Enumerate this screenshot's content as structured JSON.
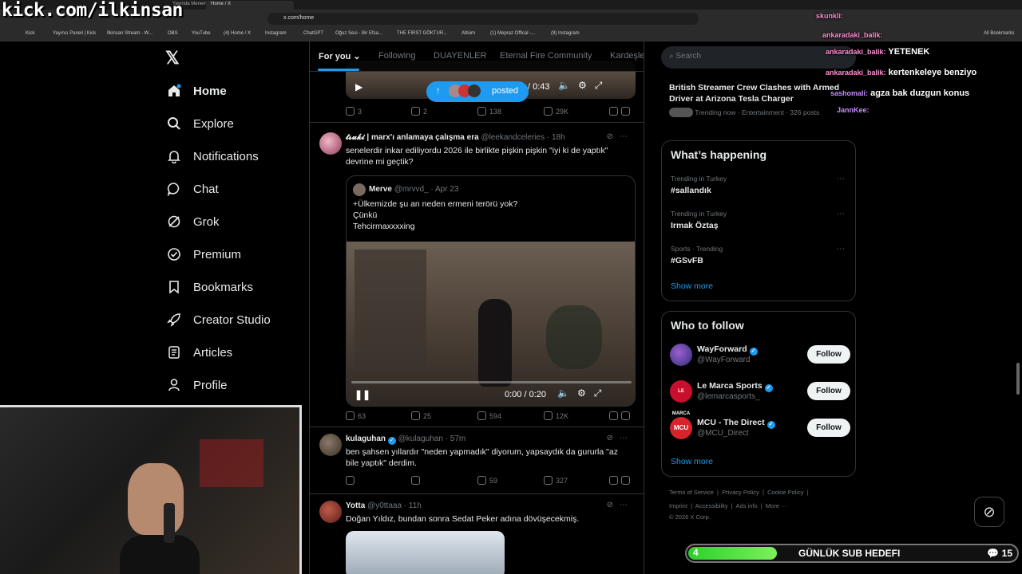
{
  "browser": {
    "tabs": [
      "Yayında Menemen - TARKAN - Yo",
      "Home / X"
    ],
    "url": "x.com/home",
    "bookmarks": [
      "Kick",
      "Yayıncı Paneli | Kick",
      "İlkinsan Stream - W...",
      "OBS",
      "YouTube",
      "(4) Home / X",
      "Instagram",
      "ChatGPT",
      "Oğuz Sesi - Bir Efsa...",
      "THE FIRST GÖKTUR...",
      "Albüm",
      "(1) Mepraz Offical -...",
      "(9) Instagram",
      "All Bookmarks"
    ]
  },
  "overlay": {
    "kick_url": "kick.com/ilkinsan"
  },
  "sidebar": {
    "items": [
      {
        "label": "Home",
        "icon": "home-icon"
      },
      {
        "label": "Explore",
        "icon": "search-icon"
      },
      {
        "label": "Notifications",
        "icon": "bell-icon"
      },
      {
        "label": "Chat",
        "icon": "chat-icon"
      },
      {
        "label": "Grok",
        "icon": "grok-icon"
      },
      {
        "label": "Premium",
        "icon": "premium-icon"
      },
      {
        "label": "Bookmarks",
        "icon": "bookmark-icon"
      },
      {
        "label": "Creator Studio",
        "icon": "rocket-icon"
      },
      {
        "label": "Articles",
        "icon": "article-icon"
      },
      {
        "label": "Profile",
        "icon": "person-icon"
      }
    ]
  },
  "feed": {
    "tabs": [
      "For you",
      "Following",
      "DUAYENLER",
      "Eternal Fire Community",
      "Kardeşle"
    ],
    "posted_pill": "posted",
    "top_tweet": {
      "video_time": "/ 0:43",
      "stats": {
        "replies": "3",
        "reposts": "2",
        "likes": "138",
        "views": "29K"
      }
    },
    "tweet1": {
      "name": "𝓽𝓼𝓾𝓴𝓲 | marx'ı anlamaya çalışma era",
      "handle": "@leekandceleries",
      "time": "· 18h",
      "text": "senelerdir inkar ediliyordu 2026 ile birlikte pişkin pişkin \"iyi ki de yaptık\" devrine mi geçtik?",
      "quote": {
        "name": "Merve",
        "handle": "@mrvvd_",
        "time": "· Apr 23",
        "lines": [
          "+Ülkemizde şu an neden ermeni terörü yok?",
          "Çünkü",
          "Tehcirmaxxxxing"
        ],
        "video_time": "0:00 / 0:20",
        "progress": 0.0
      },
      "stats": {
        "replies": "63",
        "reposts": "25",
        "likes": "594",
        "views": "12K"
      }
    },
    "tweet2": {
      "name": "kulaguhan",
      "handle": "@kulaguhan",
      "time": "· 57m",
      "text": "ben şahsen yıllardır \"neden yapmadık\" diyorum, yapsaydık da gururla \"az bile yaptık\" derdim.",
      "stats": {
        "replies": "",
        "reposts": "",
        "likes": "59",
        "views": "327"
      }
    },
    "tweet3": {
      "name": "Yotta",
      "handle": "@y0ttaaa",
      "time": "· 11h",
      "text": "Doğan Yıldız, bundan sonra Sedat Peker adına dövüşecekmiş."
    }
  },
  "right": {
    "search_placeholder": "Search",
    "top_news": {
      "title": "British Streamer Crew Clashes with Armed Driver at Arizona Tesla Charger",
      "meta": "Trending now · Entertainment · 326 posts"
    },
    "happening": {
      "title": "What’s happening",
      "trends": [
        {
          "meta": "Trending in Turkey",
          "name": "#sallandık"
        },
        {
          "meta": "Trending in Turkey",
          "name": "Irmak Öztaş"
        },
        {
          "meta": "Sports · Trending",
          "name": "#GSvFB"
        }
      ],
      "show_more": "Show more"
    },
    "who_to_follow": {
      "title": "Who to follow",
      "accounts": [
        {
          "name": "WayForward",
          "handle": "@WayForward",
          "button": "Follow"
        },
        {
          "name": "Le Marca Sports",
          "handle": "@lemarcasports_",
          "button": "Follow"
        },
        {
          "name": "MCU - The Direct",
          "handle": "@MCU_Direct",
          "button": "Follow"
        }
      ],
      "show_more": "Show more"
    },
    "footer": {
      "links": [
        "Terms of Service",
        "Privacy Policy",
        "Cookie Policy",
        "Imprint",
        "Accessibility",
        "Ads info",
        "More ···"
      ],
      "copyright": "© 2026 X Corp."
    }
  },
  "chat": [
    {
      "user": "skunkli:",
      "msg": ""
    },
    {
      "user": "ankaradaki_balik:",
      "msg": ""
    },
    {
      "user": "ankaradaki_balik:",
      "msg": "YETENEK"
    },
    {
      "user": "ankaradaki_balik:",
      "msg": "kertenkeleye benziyo"
    },
    {
      "user": "sashomali:",
      "msg": "agza bak duzgun konus"
    },
    {
      "user": "JannKee:",
      "msg": ""
    }
  ],
  "sub_goal": {
    "label": "GÜNLÜK SUB HEDEFI",
    "current": "4",
    "target": "15",
    "progress": 0.27
  },
  "colors": {
    "accent": "#1d9bf0",
    "background": "#000000",
    "goal_fill": "#2bd12b"
  }
}
